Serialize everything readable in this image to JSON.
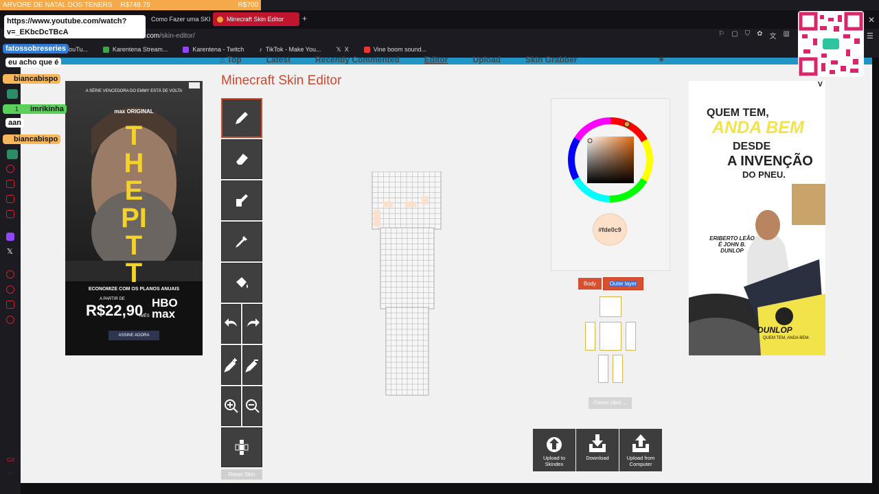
{
  "overlay": {
    "top_text": "ARVORE DE NATAL DOS TENERS",
    "top_price_1": "R$748.75",
    "top_price_2": "R$700",
    "url_bubble": "https://www.youtube.com/watch?v=_EKbcDcTBcA",
    "messages": [
      {
        "user": "fatossobreseries",
        "text": "eu acho que é"
      },
      {
        "user": "biancabispo",
        "text": ""
      },
      {
        "user": "imrikinha",
        "badge": "1",
        "text": "aan"
      },
      {
        "user": "biancabispo",
        "text": ""
      }
    ]
  },
  "browser": {
    "tabs": [
      {
        "label": "Como Fazer uma SKIN"
      },
      {
        "label": "Minecraft Skin Editor",
        "active": true
      }
    ],
    "url_prefix": "ns.com",
    "url_path": "/skin-editor/",
    "bookmarks": [
      {
        "label": "YouTu...",
        "color": "#e33"
      },
      {
        "label": "Karentena Stream...",
        "color": "#3fa34d"
      },
      {
        "label": "Karentena - Twitch",
        "color": "#9146ff"
      },
      {
        "label": "TikTok - Make You...",
        "color": "#222"
      },
      {
        "label": "X",
        "color": "#222"
      },
      {
        "label": "Vine boom sound...",
        "color": "#e33"
      }
    ]
  },
  "site": {
    "nav": [
      "Top",
      "Latest",
      "Recently Commented",
      "Editor",
      "Upload",
      "Skin Grabber"
    ],
    "active_nav": "Editor",
    "title": "Minecraft Skin Editor"
  },
  "tools": [
    {
      "name": "pencil",
      "icon": "pencil-icon",
      "selected": true
    },
    {
      "name": "eraser",
      "icon": "eraser-icon"
    },
    {
      "name": "bucket",
      "icon": "paint-bucket-icon"
    },
    {
      "name": "picker",
      "icon": "eyedropper-icon"
    },
    {
      "name": "fill",
      "icon": "fill-icon"
    },
    {
      "name": "undo",
      "icon": "undo-icon"
    },
    {
      "name": "redo",
      "icon": "redo-icon"
    },
    {
      "name": "lighten",
      "icon": "lighten-icon"
    },
    {
      "name": "darken",
      "icon": "darken-icon"
    },
    {
      "name": "zoom-in",
      "icon": "zoom-in-icon"
    },
    {
      "name": "zoom-out",
      "icon": "zoom-out-icon"
    },
    {
      "name": "toggle-parts",
      "icon": "body-toggle-icon"
    }
  ],
  "reset_label": "Reset Skin",
  "color": {
    "hex_label": "#fde0c9",
    "swatch": "#fde0c9"
  },
  "layers": {
    "body": "Body",
    "outer": "Outer layer",
    "active": "outer"
  },
  "model_select": "Classic (4px)",
  "actions": [
    {
      "label_1": "Upload to",
      "label_2": "Skindex"
    },
    {
      "label_1": "Download",
      "label_2": ""
    },
    {
      "label_1": "Upload from",
      "label_2": "Computer"
    }
  ],
  "ad_left": {
    "kicker": "A SÉRIE VENCEDORA DO EMMY ESTÁ DE VOLTA",
    "brand": "max ORIGINAL",
    "show": "THE PITT",
    "line1": "ECONOMIZE COM OS PLANOS ANUAIS",
    "line2": "A PARTIR DE",
    "price": "R$22,90",
    "per": "/MÊS",
    "logo": "HBO max",
    "cta": "ASSINE AGORA"
  },
  "ad_right": {
    "l1": "QUEM TEM,",
    "l2": "ANDA BEM",
    "l3": "DESDE",
    "l4": "A INVENÇÃO",
    "l5": "DO PNEU.",
    "caption": "ERIBERTO LEÃO É JOHN B. DUNLOP",
    "brand": "DUNLOP",
    "slogan": "QUEM TEM, ANDA BEM.",
    "close": "V"
  }
}
